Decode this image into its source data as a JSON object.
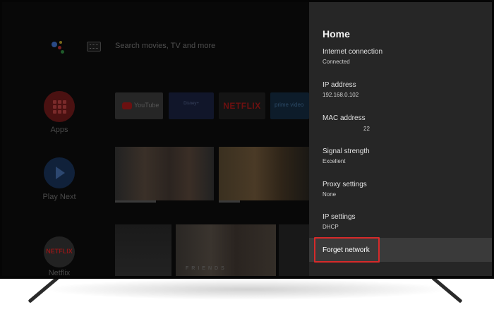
{
  "home": {
    "search_placeholder": "Search movies, TV and more",
    "sidebar": [
      {
        "label": "Apps",
        "icon": "apps-icon"
      },
      {
        "label": "Play Next",
        "icon": "play-next-icon"
      },
      {
        "label": "Netflix",
        "icon": "netflix-icon"
      }
    ],
    "apps_row": [
      {
        "name": "YouTube",
        "text": "YouTube"
      },
      {
        "name": "Disney+",
        "text": "Disney+"
      },
      {
        "name": "Netflix",
        "text": "NETFLIX"
      },
      {
        "name": "Prime Video",
        "text": "prime video"
      }
    ],
    "friends_text": "FRIENDS",
    "netflix_side_text": "NETFLIX"
  },
  "panel": {
    "title": "Home",
    "items": [
      {
        "label": "Internet connection",
        "value": "Connected"
      },
      {
        "label": "IP address",
        "value": "192.168.0.102"
      },
      {
        "label": "MAC address",
        "value": "22"
      },
      {
        "label": "Signal strength",
        "value": "Excellent"
      },
      {
        "label": "Proxy settings",
        "value": "None"
      },
      {
        "label": "IP settings",
        "value": "DHCP"
      }
    ],
    "forget_label": "Forget network"
  },
  "colors": {
    "panel_bg": "#262626",
    "selected_row_bg": "#3a3a3a",
    "highlight_border": "#d62a2a",
    "tv_bezel": "#050505"
  }
}
